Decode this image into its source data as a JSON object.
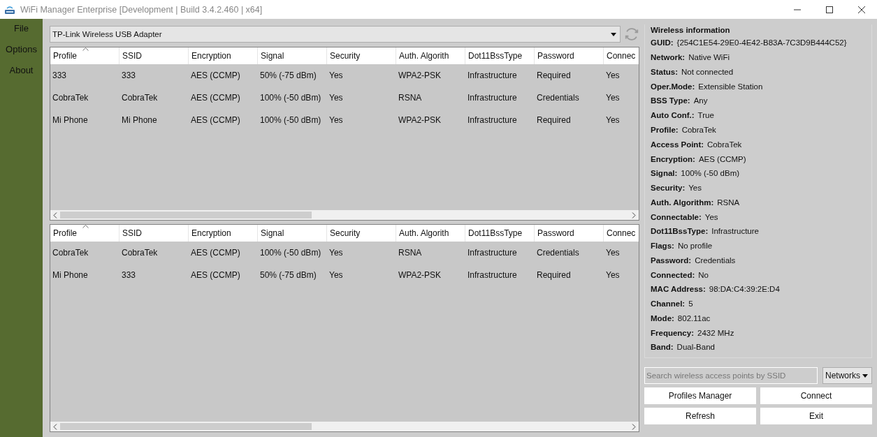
{
  "window": {
    "title": "WiFi Manager Enterprise [Development | Build 3.4.2.460 | x64]"
  },
  "menu": [
    "File",
    "Options",
    "About"
  ],
  "adapter": {
    "value": "TP-Link Wireless USB Adapter"
  },
  "profiles_table": {
    "columns": [
      "Profile",
      "SSID",
      "Encryption",
      "Signal",
      "Security",
      "Auth. Algorith",
      "Dot11BssType",
      "Password",
      "Connec"
    ],
    "rows": [
      [
        "333",
        "333",
        "AES (CCMP)",
        "50% (-75 dBm)",
        "Yes",
        "WPA2-PSK",
        "Infrastructure",
        "Required",
        "Yes"
      ],
      [
        "CobraTek",
        "CobraTek",
        "AES (CCMP)",
        "100% (-50 dBm)",
        "Yes",
        "RSNA",
        "Infrastructure",
        "Credentials",
        "Yes"
      ],
      [
        "Mi Phone",
        "Mi Phone",
        "AES (CCMP)",
        "100% (-50 dBm)",
        "Yes",
        "WPA2-PSK",
        "Infrastructure",
        "Required",
        "Yes"
      ]
    ]
  },
  "networks_table": {
    "columns": [
      "Profile",
      "SSID",
      "Encryption",
      "Signal",
      "Security",
      "Auth. Algorith",
      "Dot11BssType",
      "Password",
      "Connec"
    ],
    "rows": [
      [
        "CobraTek",
        "CobraTek",
        "AES (CCMP)",
        "100% (-50 dBm)",
        "Yes",
        "RSNA",
        "Infrastructure",
        "Credentials",
        "Yes"
      ],
      [
        "Mi Phone",
        "333",
        "AES (CCMP)",
        "50% (-75 dBm)",
        "Yes",
        "WPA2-PSK",
        "Infrastructure",
        "Required",
        "Yes"
      ]
    ]
  },
  "wireless_information": {
    "title": "Wireless information",
    "fields": [
      {
        "label": "GUID:",
        "value": "{254C1E54-29E0-4E42-B83A-7C3D9B444C52}"
      },
      {
        "label": "Network:",
        "value": "Native WiFi"
      },
      {
        "label": "Status:",
        "value": "Not connected"
      },
      {
        "label": "Oper.Mode:",
        "value": "Extensible Station"
      },
      {
        "label": "BSS Type:",
        "value": "Any"
      },
      {
        "label": "Auto Conf.:",
        "value": "True"
      },
      {
        "label": "Profile:",
        "value": "CobraTek"
      },
      {
        "label": "Access Point:",
        "value": "CobraTek"
      },
      {
        "label": "Encryption:",
        "value": "AES (CCMP)"
      },
      {
        "label": "Signal:",
        "value": "100% (-50 dBm)"
      },
      {
        "label": "Security:",
        "value": "Yes"
      },
      {
        "label": "Auth. Algorithm:",
        "value": "RSNA"
      },
      {
        "label": "Connectable:",
        "value": "Yes"
      },
      {
        "label": "Dot11BssType:",
        "value": "Infrastructure"
      },
      {
        "label": "Flags:",
        "value": "No profile"
      },
      {
        "label": "Password:",
        "value": "Credentials"
      },
      {
        "label": "Connected:",
        "value": "No"
      },
      {
        "label": "MAC Address:",
        "value": "98:DA:C4:39:2E:D4"
      },
      {
        "label": "Channel:",
        "value": "5"
      },
      {
        "label": "Mode:",
        "value": "802.11ac"
      },
      {
        "label": "Frequency:",
        "value": "2432 MHz"
      },
      {
        "label": "Band:",
        "value": "Dual-Band"
      }
    ]
  },
  "search": {
    "placeholder": "Search wireless access points by SSID"
  },
  "view_select": {
    "value": "Networks"
  },
  "buttons": [
    "Profiles Manager",
    "Connect",
    "Refresh",
    "Exit"
  ]
}
